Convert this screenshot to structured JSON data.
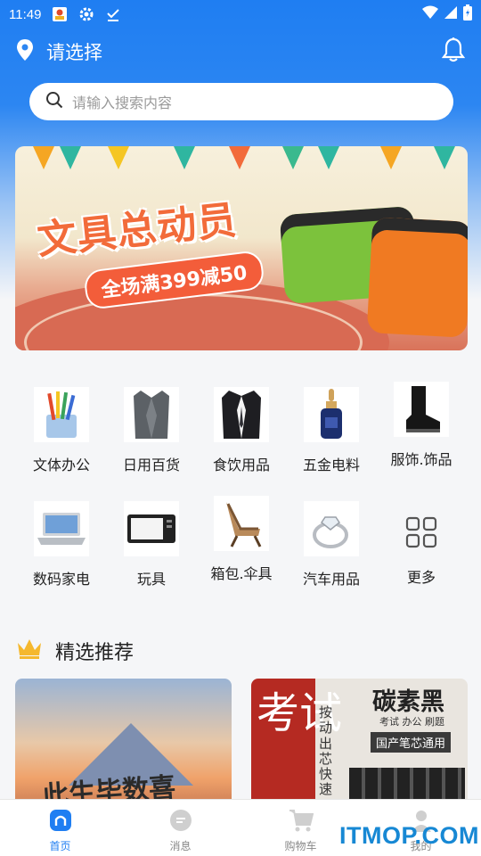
{
  "status_bar": {
    "time": "11:49"
  },
  "header": {
    "location_label": "请选择"
  },
  "search": {
    "placeholder": "请输入搜索内容"
  },
  "banner": {
    "title": "文具总动员",
    "subtitle": "全场满399减50"
  },
  "categories": [
    {
      "label": "文体办公",
      "icon": "pencil-cup"
    },
    {
      "label": "日用百货",
      "icon": "blazer-gray"
    },
    {
      "label": "食饮用品",
      "icon": "suit-black"
    },
    {
      "label": "五金电料",
      "icon": "serum-bottle"
    },
    {
      "label": "服饰.饰品",
      "icon": "black-boot"
    },
    {
      "label": "数码家电",
      "icon": "laptop"
    },
    {
      "label": "玩具",
      "icon": "microwave"
    },
    {
      "label": "箱包.伞具",
      "icon": "lounge-chair"
    },
    {
      "label": "汽车用品",
      "icon": "ring"
    },
    {
      "label": "更多",
      "icon": "grid-icon"
    }
  ],
  "section": {
    "title": "精选推荐"
  },
  "products": [
    {
      "image_text": "此生毕数喜"
    },
    {
      "big_text": "考试",
      "brand": "碳素黑",
      "tags": "考试 办公 刷题",
      "band": "国产笔芯通用",
      "vertical": "按动出芯快速"
    }
  ],
  "bottom_nav": [
    {
      "label": "首页",
      "icon": "home-icon",
      "active": true
    },
    {
      "label": "消息",
      "icon": "message-icon",
      "active": false
    },
    {
      "label": "购物车",
      "icon": "cart-icon",
      "active": false
    },
    {
      "label": "我的",
      "icon": "user-icon",
      "active": false
    }
  ],
  "watermark": "ITMOP.COM",
  "colors": {
    "primary": "#1f7ef2",
    "banner_orange": "#f26b3a"
  }
}
